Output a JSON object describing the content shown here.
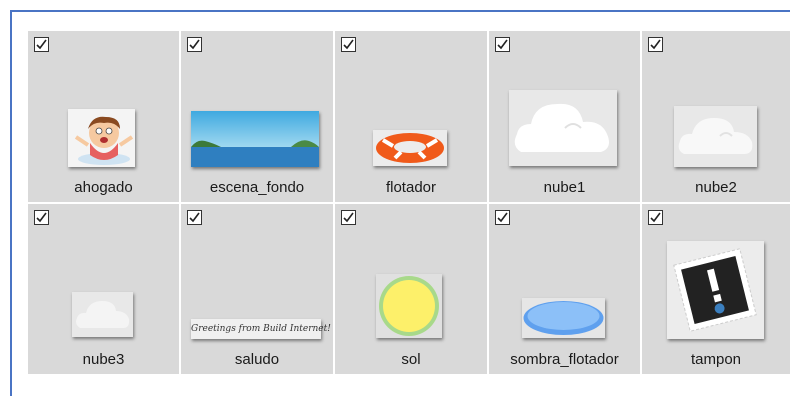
{
  "items": [
    {
      "name": "ahogado",
      "checked": true
    },
    {
      "name": "escena_fondo",
      "checked": true
    },
    {
      "name": "flotador",
      "checked": true
    },
    {
      "name": "nube1",
      "checked": true
    },
    {
      "name": "nube2",
      "checked": true
    },
    {
      "name": "nube3",
      "checked": true
    },
    {
      "name": "saludo",
      "checked": true
    },
    {
      "name": "sol",
      "checked": true
    },
    {
      "name": "sombra_flotador",
      "checked": true
    },
    {
      "name": "tampon",
      "checked": true
    }
  ],
  "saludo_text": "Greetings from Build Internet!",
  "colors": {
    "frame": "#4a74c4",
    "cell_bg": "#d9d9d9",
    "sun_fill": "#fdf06a",
    "shadow_fill": "#7fb3f5"
  }
}
